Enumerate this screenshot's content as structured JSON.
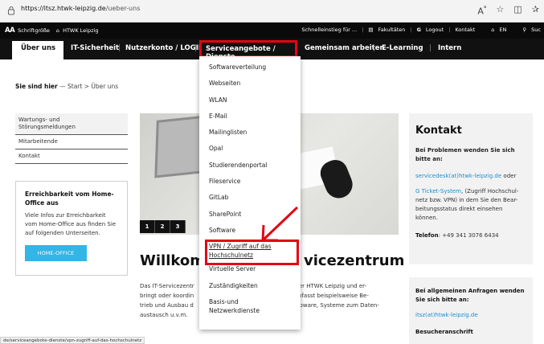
{
  "browser": {
    "url_host": "https://itsz.htwk-leipzig.de",
    "url_path": "/ueber-uns"
  },
  "utility": {
    "font_size_label": "Schriftgröße",
    "home_label": "HTWK Leipzig",
    "quick_entry": "Schnelleinstieg für ...",
    "faculties": "Fakultäten",
    "logout": "Logout",
    "contact": "Kontakt",
    "language": "EN",
    "search": "Suc"
  },
  "nav": {
    "items": [
      "Über uns",
      "IT-Sicherheit",
      "Nutzerkonto / LOGIN",
      "Serviceangebote / Dienste",
      "Gemeinsam arbeiten",
      "E-Learning",
      "Intern"
    ]
  },
  "breadcrumb": {
    "label": "Sie sind hier",
    "path": "— Start > Über uns"
  },
  "sidebar": {
    "links": [
      "Wartungs- und Störungsmeldungen",
      "Mitarbeitende",
      "Kontakt"
    ],
    "box_title": "Erreichbarkeit vom Home-Office aus",
    "box_text": "Viele Infos zur Erreichbarkeit vom Home-Office aus finden Sie auf folgenden Unterseiten.",
    "box_button": "HOME-OFFICE"
  },
  "hero": {
    "pages": [
      "1",
      "2",
      "3"
    ]
  },
  "welcome": {
    "title_start": "Willkom",
    "title_end": "vicezentrum",
    "intro_1": "Das IT-Servicezentr",
    "intro_1b": "er der HTWK Leipzig und er-",
    "intro_2": "bringt oder koordin",
    "intro_2b": "es umfasst beispielsweise Be-",
    "intro_3": "trieb und Ausbau d",
    "intro_3b": "upware, Systeme zum Daten-",
    "intro_4": "austausch u.v.m."
  },
  "contact": {
    "title": "Kontakt",
    "problems": "Bei Problemen wenden Sie sich bitte an:",
    "email": "servicedesk(at)htwk-leipzig.de",
    "email_suffix": " oder",
    "ticket_link": "Ticket-System",
    "ticket_text": ", (Zugriff Hochschul-netz bzw. VPN) in dem Sie den Bear-beitungsstatus direkt einsehen können.",
    "phone_label": "Telefon",
    "phone": ": +49 341 3076 6434",
    "general": "Bei allgemeinen Anfragen wenden Sie sich bitte an:",
    "general_email": "itsz(at)htwk-leipzig.de",
    "visitor": "Besucheranschrift"
  },
  "dropdown": {
    "items": [
      "Softwareverteilung",
      "Webseiten",
      "WLAN",
      "E-Mail",
      "Mailinglisten",
      "Opal",
      "Studierendenportal",
      "Fileservice",
      "GitLab",
      "SharePoint",
      "Software",
      "VPN / Zugriff auf das Hochschulnetz",
      "Virtuelle Server",
      "Zuständigkeiten",
      "Basis-und Netzwerkdienste"
    ]
  },
  "status": {
    "url": "de/serviceangebote-dienste/vpn-zugriff-auf-das-hochschulnetz"
  },
  "colors": {
    "highlight": "#e20613",
    "link": "#1a8ed1",
    "button": "#33b5e5"
  }
}
